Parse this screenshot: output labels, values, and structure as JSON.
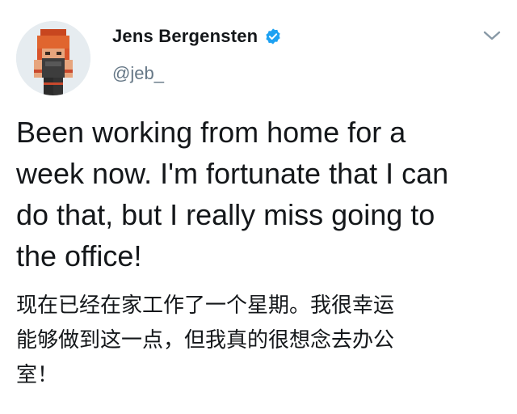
{
  "tweet": {
    "author": {
      "display_name": "Jens Bergensten",
      "handle": "@jeb_",
      "verified": true,
      "avatar_icon": "minecraft-skin-avatar",
      "verified_icon": "verified-badge-icon"
    },
    "menu_icon": "chevron-down-icon",
    "text_en": "Been working from home for a\nweek now. I'm fortunate that I can\ndo that, but I really miss going to\nthe office!",
    "text_zh": "现在已经在家工作了一个星期。我很幸运\n能够做到这一点，但我真的很想念去办公\n室！"
  },
  "colors": {
    "verified_blue": "#1da1f2",
    "handle_gray": "#657786",
    "text_dark": "#14171a",
    "avatar_bg": "#e6ecf0",
    "hair_orange": "#d9542b"
  }
}
